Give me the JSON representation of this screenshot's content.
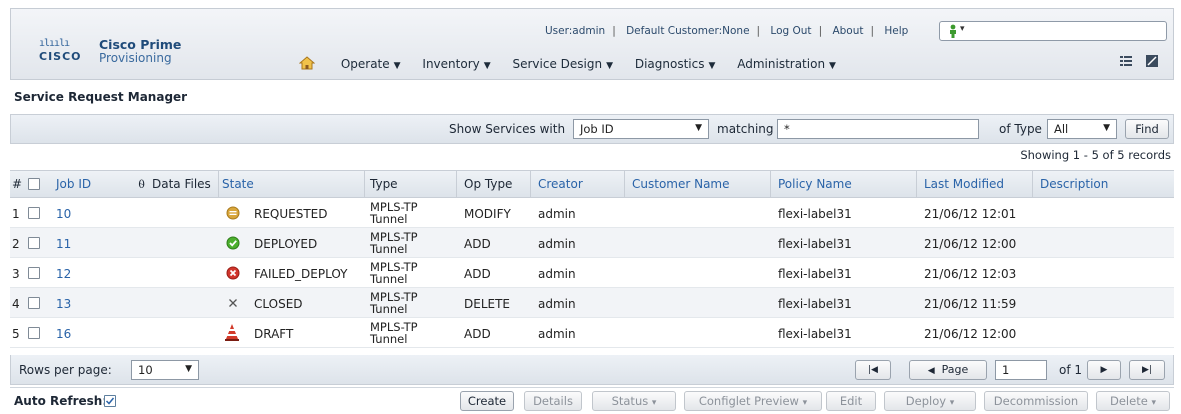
{
  "header": {
    "logo_bars": "ılıılı",
    "logo_cisco": "CISCO",
    "product_line1": "Cisco Prime",
    "product_line2": "Provisioning",
    "user": "User:admin",
    "customer": "Default Customer:None",
    "logout": "Log Out",
    "about": "About",
    "help": "Help",
    "menus": [
      {
        "label": "Operate"
      },
      {
        "label": "Inventory"
      },
      {
        "label": "Service Design"
      },
      {
        "label": "Diagnostics"
      },
      {
        "label": "Administration"
      }
    ]
  },
  "page_title": "Service Request Manager",
  "filter": {
    "show_label": "Show Services with",
    "field_value": "Job ID",
    "matching_label": "matching",
    "matching_value": "*",
    "type_label": "of Type",
    "type_value": "All",
    "find_label": "Find"
  },
  "showing": "Showing 1 - 5 of 5 records",
  "columns": {
    "num": "#",
    "job_id": "Job ID",
    "data_files": "Data Files",
    "state": "State",
    "type": "Type",
    "op_type": "Op Type",
    "creator": "Creator",
    "customer": "Customer Name",
    "policy": "Policy Name",
    "modified": "Last Modified",
    "description": "Description"
  },
  "rows": [
    {
      "num": "1",
      "job_id": "10",
      "state": "REQUESTED",
      "state_icon": "requested-icon",
      "type1": "MPLS-TP",
      "type2": "Tunnel",
      "op": "MODIFY",
      "creator": "admin",
      "customer": "",
      "policy": "flexi-label31",
      "modified": "21/06/12 12:01",
      "description": ""
    },
    {
      "num": "2",
      "job_id": "11",
      "state": "DEPLOYED",
      "state_icon": "deployed-icon",
      "type1": "MPLS-TP",
      "type2": "Tunnel",
      "op": "ADD",
      "creator": "admin",
      "customer": "",
      "policy": "flexi-label31",
      "modified": "21/06/12 12:00",
      "description": ""
    },
    {
      "num": "3",
      "job_id": "12",
      "state": "FAILED_DEPLOY",
      "state_icon": "failed-icon",
      "type1": "MPLS-TP",
      "type2": "Tunnel",
      "op": "ADD",
      "creator": "admin",
      "customer": "",
      "policy": "flexi-label31",
      "modified": "21/06/12 12:03",
      "description": ""
    },
    {
      "num": "4",
      "job_id": "13",
      "state": "CLOSED",
      "state_icon": "closed-icon",
      "type1": "MPLS-TP",
      "type2": "Tunnel",
      "op": "DELETE",
      "creator": "admin",
      "customer": "",
      "policy": "flexi-label31",
      "modified": "21/06/12 11:59",
      "description": ""
    },
    {
      "num": "5",
      "job_id": "16",
      "state": "DRAFT",
      "state_icon": "draft-icon",
      "type1": "MPLS-TP",
      "type2": "Tunnel",
      "op": "ADD",
      "creator": "admin",
      "customer": "",
      "policy": "flexi-label31",
      "modified": "21/06/12 12:00",
      "description": ""
    }
  ],
  "pager": {
    "rows_label": "Rows per page:",
    "rows_value": "10",
    "page_label": "Page",
    "page_value": "1",
    "of_label": "of 1"
  },
  "actions": {
    "auto_refresh": "Auto Refresh:",
    "create": "Create",
    "details": "Details",
    "status": "Status",
    "configlet": "Configlet Preview",
    "edit": "Edit",
    "deploy": "Deploy",
    "decommission": "Decommission",
    "delete": "Delete"
  },
  "colors": {
    "link": "#2a63a8",
    "requested": "#d9a63a",
    "deployed": "#4caf2e",
    "failed": "#d0352c",
    "draft": "#d23a2a"
  }
}
